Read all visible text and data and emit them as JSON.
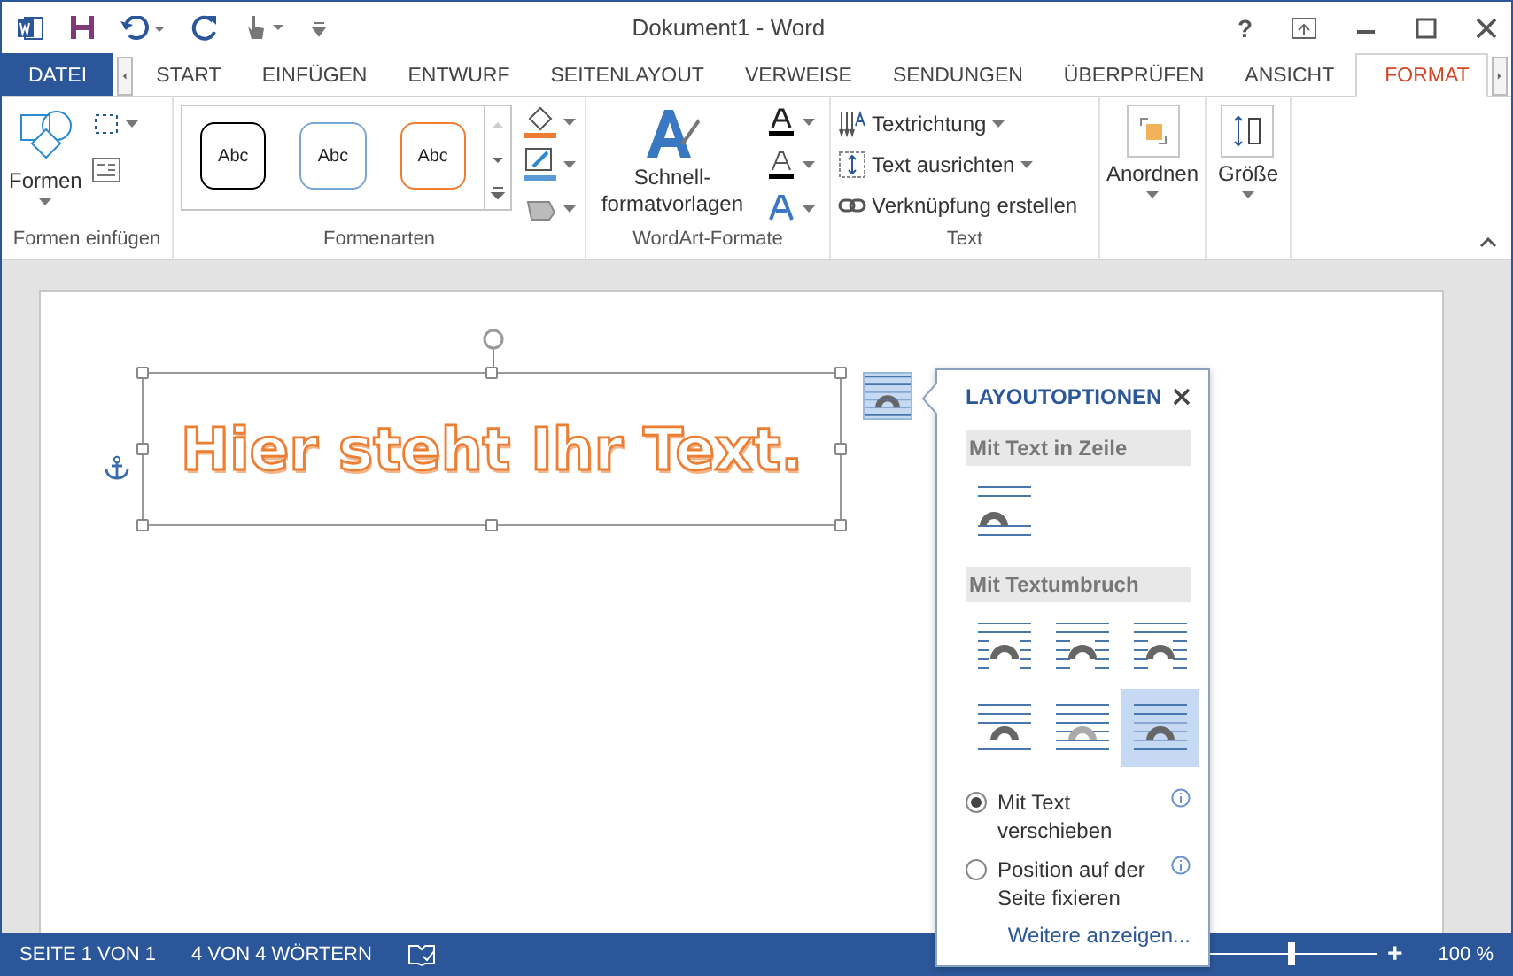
{
  "window": {
    "title": "Dokument1 - Word",
    "help": "?"
  },
  "tabs": [
    {
      "label": "DATEI",
      "kind": "file",
      "selected": false
    },
    {
      "label": "START",
      "kind": "tab",
      "selected": false
    },
    {
      "label": "EINFÜGEN",
      "kind": "tab",
      "selected": false
    },
    {
      "label": "ENTWURF",
      "kind": "tab",
      "selected": false
    },
    {
      "label": "SEITENLAYOUT",
      "kind": "tab",
      "selected": false
    },
    {
      "label": "VERWEISE",
      "kind": "tab",
      "selected": false
    },
    {
      "label": "SENDUNGEN",
      "kind": "tab",
      "selected": false
    },
    {
      "label": "ÜBERPRÜFEN",
      "kind": "tab",
      "selected": false
    },
    {
      "label": "ANSICHT",
      "kind": "tab",
      "selected": false
    },
    {
      "label": "FORMAT",
      "kind": "tab",
      "selected": true
    }
  ],
  "ribbon": {
    "insert_shapes": {
      "label": "Formen einfügen",
      "button": "Formen"
    },
    "shape_styles": {
      "label": "Formenarten",
      "samples": [
        {
          "text": "Abc",
          "color": "#000000"
        },
        {
          "text": "Abc",
          "color": "#7ba7d4"
        },
        {
          "text": "Abc",
          "color": "#ed7d31"
        }
      ]
    },
    "wordart": {
      "label": "WordArt-Formate",
      "button_lines": [
        "Schnell-",
        "formatvorlagen"
      ]
    },
    "text": {
      "label": "Text",
      "items": [
        {
          "label": "Textrichtung",
          "kind": "direction",
          "dropdown": true
        },
        {
          "label": "Text ausrichten",
          "kind": "align",
          "dropdown": true
        },
        {
          "label": "Verknüpfung erstellen",
          "kind": "link",
          "dropdown": false
        }
      ]
    },
    "arrange": {
      "button": "Anordnen"
    },
    "size": {
      "button": "Größe"
    }
  },
  "document": {
    "wordart_text": "Hier steht Ihr Text."
  },
  "layout_options": {
    "title": "LAYOUTOPTIONEN",
    "sections": [
      {
        "heading": "Mit Text in Zeile",
        "options": [
          {
            "kind": "inline",
            "selected": false
          }
        ]
      },
      {
        "heading": "Mit Textumbruch",
        "options": [
          {
            "kind": "square",
            "selected": false
          },
          {
            "kind": "tight",
            "selected": false
          },
          {
            "kind": "through",
            "selected": false
          },
          {
            "kind": "topbottom",
            "selected": false
          },
          {
            "kind": "behind",
            "selected": false
          },
          {
            "kind": "front",
            "selected": true
          }
        ]
      }
    ],
    "radios": [
      {
        "label": "Mit Text verschieben",
        "selected": true
      },
      {
        "label": "Position auf der Seite fixieren",
        "selected": false
      }
    ],
    "link": "Weitere anzeigen..."
  },
  "status_bar": {
    "page": "SEITE 1 VON 1",
    "words": "4 VON 4 WÖRTERN",
    "zoom": {
      "level": 0.5,
      "plus": "+",
      "reading": "100 %"
    }
  }
}
